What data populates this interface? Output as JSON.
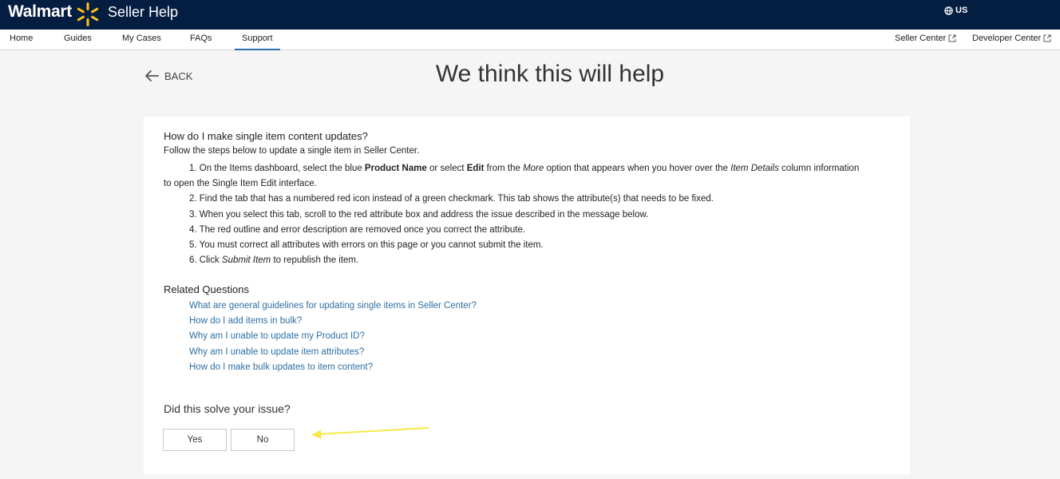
{
  "header": {
    "brand": "Walmart",
    "app_title": "Seller Help",
    "region": "US"
  },
  "nav": {
    "items": [
      {
        "label": "Home"
      },
      {
        "label": "Guides"
      },
      {
        "label": "My Cases"
      },
      {
        "label": "FAQs"
      },
      {
        "label": "Support",
        "active": true
      }
    ],
    "right_links": [
      {
        "label": "Seller Center"
      },
      {
        "label": "Developer Center"
      }
    ]
  },
  "page": {
    "back_label": "BACK",
    "heading": "We think this will help"
  },
  "article": {
    "question": "How do I make single item content updates?",
    "intro": "Follow the steps below to update a single item in Seller Center.",
    "steps": {
      "s1_a": "1. On the Items dashboard, select the blue ",
      "s1_b": "Product Name",
      "s1_c": " or select ",
      "s1_d": "Edit",
      "s1_e": " from the ",
      "s1_f": "More",
      "s1_g": " option that appears when you hover over the ",
      "s1_h": "Item Details",
      "s1_i": " column information",
      "s1_j": "to open the Single Item Edit interface.",
      "s2": "2. Find the tab that has a numbered red icon instead of a green checkmark. This tab shows the attribute(s) that needs to be fixed.",
      "s3": "3. When you select this tab, scroll to the red attribute box and address the issue described in the message below.",
      "s4": "4. The red outline and error description are removed once you correct the attribute.",
      "s5": "5. You must correct all attributes with errors on this page or you cannot submit the item.",
      "s6_a": "6. Click ",
      "s6_b": "Submit Item",
      "s6_c": " to republish the item."
    }
  },
  "related": {
    "title": "Related Questions",
    "links": [
      "What are general guidelines for updating single items in Seller Center?",
      "How do I add items in bulk?",
      "Why am I unable to update my Product ID?",
      "Why am I unable to update item attributes?",
      "How do I make bulk updates to item content?"
    ]
  },
  "feedback": {
    "question": "Did this solve your issue?",
    "yes_label": "Yes",
    "no_label": "No"
  },
  "colors": {
    "header_bg": "#041e42",
    "spark": "#ffc220",
    "link": "#2e6fa3",
    "annotation_arrow": "#f5e94a"
  }
}
